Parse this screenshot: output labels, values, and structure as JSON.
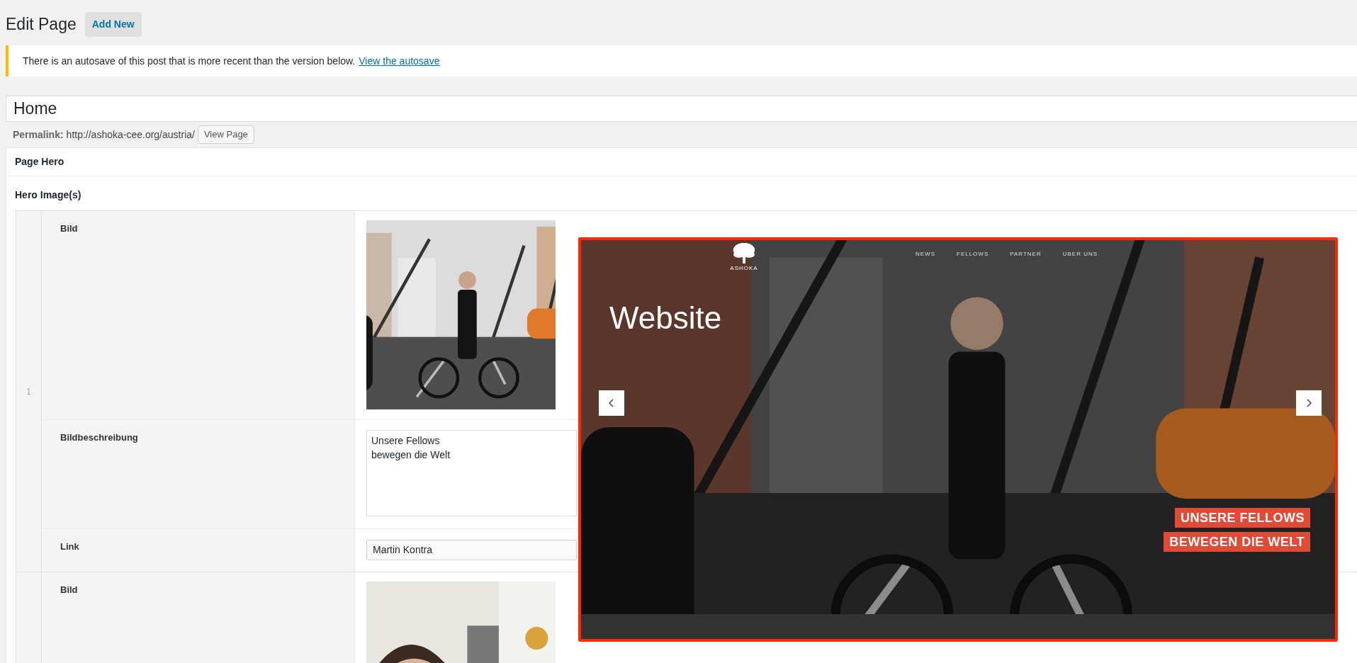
{
  "header": {
    "title": "Edit Page",
    "add_new": "Add New"
  },
  "notice": {
    "text": "There is an autosave of this post that is more recent than the version below.",
    "link": "View the autosave"
  },
  "title_field": {
    "value": "Home"
  },
  "permalink": {
    "label": "Permalink:",
    "url": "http://ashoka-cee.org/austria/",
    "button": "View Page"
  },
  "metabox": {
    "title": "Page Hero",
    "field_label": "Hero Image(s)",
    "rows": [
      {
        "number": "1",
        "fields": [
          {
            "label": "Bild"
          },
          {
            "kind": "textarea",
            "label": "Bildbeschreibung",
            "value": "Unsere Fellows\nbewegen die Welt"
          },
          {
            "kind": "select",
            "label": "Link",
            "value": "Martin Kontra"
          }
        ]
      },
      {
        "fields": [
          {
            "label": "Bild"
          }
        ]
      }
    ]
  },
  "overlay": {
    "logo_text": "ASHOKA",
    "nav": [
      "NEWS",
      "FELLOWS",
      "PARTNER",
      "ÜBER UNS"
    ],
    "heading": "Website",
    "captions": [
      "UNSERE FELLOWS",
      "BEWEGEN DIE WELT"
    ]
  }
}
